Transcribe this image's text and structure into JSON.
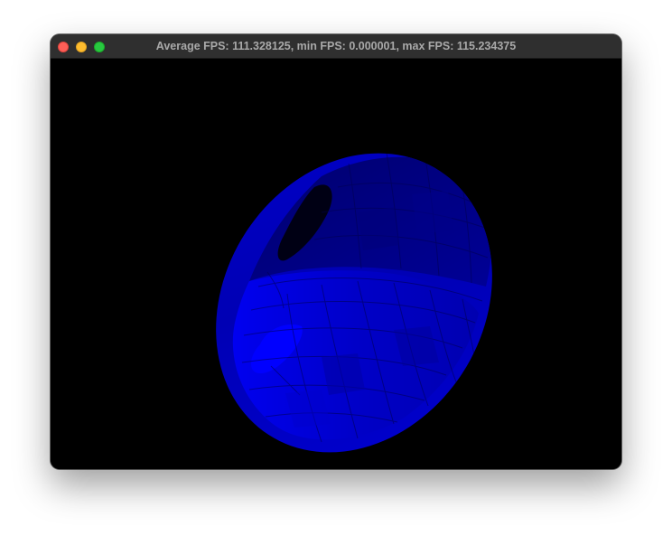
{
  "window": {
    "title": "Average FPS: 111.328125, min FPS: 0.000001, max FPS: 115.234375"
  },
  "scene": {
    "background_color": "#000000",
    "object": "torus",
    "object_color": "#0000ff"
  },
  "colors": {
    "close": "#fe5f57",
    "minimize": "#febc2e",
    "zoom": "#28c840"
  }
}
